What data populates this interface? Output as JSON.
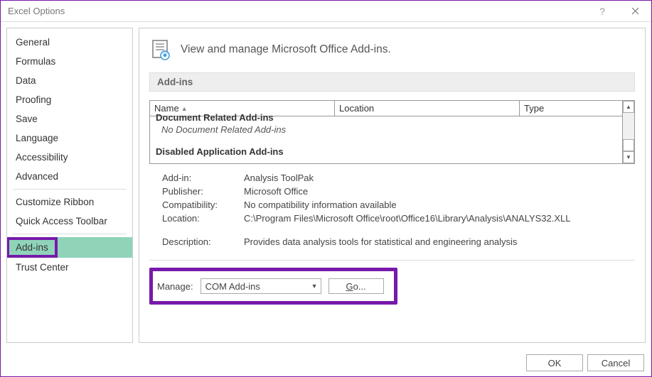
{
  "window": {
    "title": "Excel Options"
  },
  "sidebar": {
    "items": [
      {
        "label": "General"
      },
      {
        "label": "Formulas"
      },
      {
        "label": "Data"
      },
      {
        "label": "Proofing"
      },
      {
        "label": "Save"
      },
      {
        "label": "Language"
      },
      {
        "label": "Accessibility"
      },
      {
        "label": "Advanced"
      },
      {
        "label": "Customize Ribbon"
      },
      {
        "label": "Quick Access Toolbar"
      },
      {
        "label": "Add-ins",
        "selected": true
      },
      {
        "label": "Trust Center"
      }
    ]
  },
  "heading": "View and manage Microsoft Office Add-ins.",
  "section_title": "Add-ins",
  "columns": {
    "name": "Name",
    "location": "Location",
    "type": "Type"
  },
  "groups": {
    "doc_related": "Document Related Add-ins",
    "doc_related_empty": "No Document Related Add-ins",
    "disabled": "Disabled Application Add-ins"
  },
  "details": {
    "addin_label": "Add-in:",
    "addin_value": "Analysis ToolPak",
    "publisher_label": "Publisher:",
    "publisher_value": "Microsoft Office",
    "compat_label": "Compatibility:",
    "compat_value": "No compatibility information available",
    "location_label": "Location:",
    "location_value": "C:\\Program Files\\Microsoft Office\\root\\Office16\\Library\\Analysis\\ANALYS32.XLL",
    "desc_label": "Description:",
    "desc_value": "Provides data analysis tools for statistical and engineering analysis"
  },
  "manage": {
    "label": "Manage:",
    "selected": "COM Add-ins",
    "go_prefix": "G",
    "go_suffix": "o..."
  },
  "footer": {
    "ok": "OK",
    "cancel": "Cancel"
  }
}
